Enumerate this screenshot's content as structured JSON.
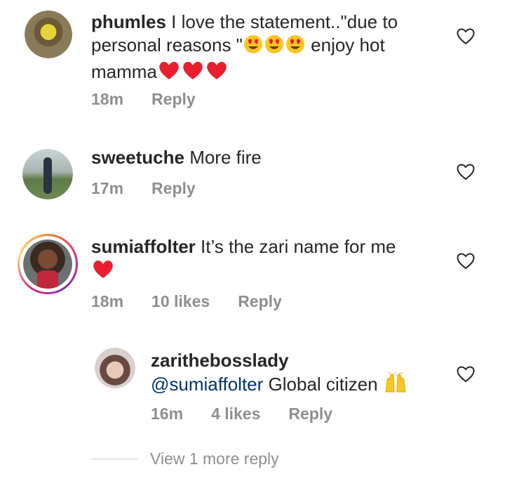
{
  "comments": [
    {
      "username": "phumles",
      "text_a": "I love the statement..\"due to",
      "text_b": "personal reasons \"",
      "text_c": " enjoy hot",
      "text_d": "mamma",
      "time": "18m",
      "reply": "Reply",
      "emoji": [
        "heart-eyes",
        "heart-eyes",
        "heart-eyes",
        "red-heart",
        "red-heart",
        "red-heart"
      ]
    },
    {
      "username": "sweetuche",
      "text": "More fire",
      "time": "17m",
      "reply": "Reply"
    },
    {
      "username": "sumiaffolter",
      "text": "It’s the zari name for me",
      "time": "18m",
      "likes": "10 likes",
      "reply": "Reply",
      "emoji": [
        "red-heart"
      ]
    }
  ],
  "reply_comment": {
    "username": "zarithebosslady",
    "mention": "@sumiaffolter",
    "text": "Global citizen",
    "time": "16m",
    "likes": "4 likes",
    "reply": "Reply",
    "emoji": [
      "raising-hands"
    ]
  },
  "view_more": "View 1 more reply",
  "colors": {
    "text": "#262626",
    "meta": "#8e8e8e",
    "mention": "#003569",
    "heart": "#ed4956"
  }
}
